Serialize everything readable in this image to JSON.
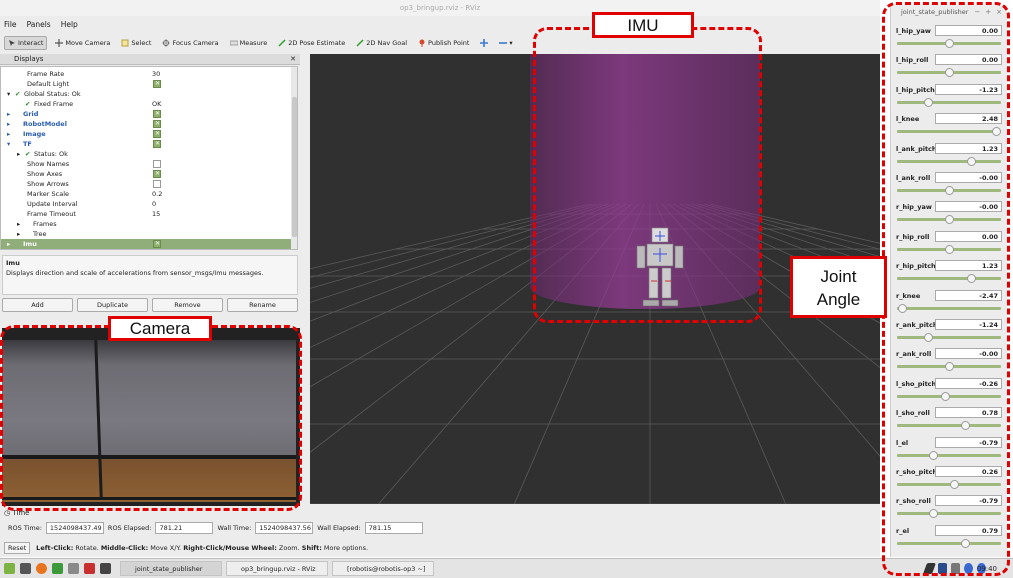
{
  "window": {
    "title": "op3_bringup.rviz - RViz"
  },
  "menu": [
    "File",
    "Panels",
    "Help"
  ],
  "toolbar": {
    "tools": [
      {
        "label": "Interact",
        "icon": "interact-icon",
        "active": true
      },
      {
        "label": "Move Camera",
        "icon": "move-camera-icon"
      },
      {
        "label": "Select",
        "icon": "select-icon"
      },
      {
        "label": "Focus Camera",
        "icon": "focus-camera-icon"
      },
      {
        "label": "Measure",
        "icon": "measure-icon"
      },
      {
        "label": "2D Pose Estimate",
        "icon": "pose-estimate-icon"
      },
      {
        "label": "2D Nav Goal",
        "icon": "nav-goal-icon"
      },
      {
        "label": "Publish Point",
        "icon": "publish-point-icon"
      }
    ]
  },
  "displays": {
    "title": "Displays",
    "rows": [
      {
        "label": "Frame Rate",
        "value": "30",
        "indent": 2
      },
      {
        "label": "Default Light",
        "check": true,
        "indent": 2
      },
      {
        "label": "Global Status: Ok",
        "indent": 1,
        "arrow": "▾",
        "tick": true
      },
      {
        "label": "Fixed Frame",
        "value": "OK",
        "indent": 2,
        "tick": true
      },
      {
        "label": "Grid",
        "check": true,
        "indent": 1,
        "arrow": "▸",
        "blue": true
      },
      {
        "label": "RobotModel",
        "check": true,
        "indent": 1,
        "arrow": "▸",
        "blue": true
      },
      {
        "label": "Image",
        "check": true,
        "indent": 1,
        "arrow": "▸",
        "blue": true
      },
      {
        "label": "TF",
        "check": true,
        "indent": 1,
        "arrow": "▾",
        "blue": true
      },
      {
        "label": "Status: Ok",
        "indent": 2,
        "arrow": "▸",
        "tick": true
      },
      {
        "label": "Show Names",
        "check": false,
        "indent": 2
      },
      {
        "label": "Show Axes",
        "check": true,
        "indent": 2
      },
      {
        "label": "Show Arrows",
        "check": false,
        "indent": 2
      },
      {
        "label": "Marker Scale",
        "value": "0.2",
        "indent": 2
      },
      {
        "label": "Update Interval",
        "value": "0",
        "indent": 2
      },
      {
        "label": "Frame Timeout",
        "value": "15",
        "indent": 2
      },
      {
        "label": "Frames",
        "indent": 2,
        "arrow": "▸"
      },
      {
        "label": "Tree",
        "indent": 2,
        "arrow": "▸"
      },
      {
        "label": "Imu",
        "check": true,
        "indent": 1,
        "arrow": "▸",
        "selected": true
      }
    ]
  },
  "description": {
    "title": "Imu",
    "text": "Displays direction and scale of accelerations from sensor_msgs/Imu messages."
  },
  "buttons": {
    "add": "Add",
    "duplicate": "Duplicate",
    "remove": "Remove",
    "rename": "Rename"
  },
  "time": {
    "title": "Time",
    "ros_time_label": "ROS Time:",
    "ros_time": "1524098437.49",
    "ros_elapsed_label": "ROS Elapsed:",
    "ros_elapsed": "781.21",
    "wall_time_label": "Wall Time:",
    "wall_time": "1524098437.56",
    "wall_elapsed_label": "Wall Elapsed:",
    "wall_elapsed": "781.15"
  },
  "status": {
    "reset": "Reset",
    "hint_b1": "Left-Click:",
    "hint_t1": " Rotate. ",
    "hint_b2": "Middle-Click:",
    "hint_t2": " Move X/Y. ",
    "hint_b3": "Right-Click/Mouse Wheel:",
    "hint_t3": " Zoom. ",
    "hint_b4": "Shift:",
    "hint_t4": " More options."
  },
  "joint_state_publisher": {
    "title": "joint_state_publisher",
    "controls": [
      "−",
      "+",
      "×"
    ],
    "joints": [
      {
        "name": "l_hip_yaw",
        "value": "0.00",
        "pos": 0.5
      },
      {
        "name": "l_hip_roll",
        "value": "0.00",
        "pos": 0.5
      },
      {
        "name": "l_hip_pitch",
        "value": "-1.23",
        "pos": 0.3
      },
      {
        "name": "l_knee",
        "value": "2.48",
        "pos": 0.95
      },
      {
        "name": "l_ank_pitch",
        "value": "1.23",
        "pos": 0.71
      },
      {
        "name": "l_ank_roll",
        "value": "-0.00",
        "pos": 0.5
      },
      {
        "name": "r_hip_yaw",
        "value": "-0.00",
        "pos": 0.5
      },
      {
        "name": "r_hip_roll",
        "value": "0.00",
        "pos": 0.5
      },
      {
        "name": "r_hip_pitch",
        "value": "1.23",
        "pos": 0.71
      },
      {
        "name": "r_knee",
        "value": "-2.47",
        "pos": 0.05
      },
      {
        "name": "r_ank_pitch",
        "value": "-1.24",
        "pos": 0.3
      },
      {
        "name": "r_ank_roll",
        "value": "-0.00",
        "pos": 0.5
      },
      {
        "name": "l_sho_pitch",
        "value": "-0.26",
        "pos": 0.46
      },
      {
        "name": "l_sho_roll",
        "value": "0.78",
        "pos": 0.65
      },
      {
        "name": "l_el",
        "value": "-0.79",
        "pos": 0.35
      },
      {
        "name": "r_sho_pitch",
        "value": "0.26",
        "pos": 0.55
      },
      {
        "name": "r_sho_roll",
        "value": "-0.79",
        "pos": 0.35
      },
      {
        "name": "r_el",
        "value": "0.79",
        "pos": 0.65
      }
    ]
  },
  "taskbar": {
    "tasks": [
      {
        "label": "joint_state_publisher",
        "active": true
      },
      {
        "label": "op3_bringup.rviz - RViz"
      },
      {
        "label": "[robotis@robotis-op3 ~]"
      }
    ],
    "clock": "09:40"
  },
  "annotations": {
    "imu": "IMU",
    "camera": "Camera",
    "joint_angle_line1": "Joint",
    "joint_angle_line2": "Angle"
  },
  "colors": {
    "annotation": "#e00000",
    "imu_volume": "#8a3a8a",
    "slider_track": "#9fb87e"
  }
}
